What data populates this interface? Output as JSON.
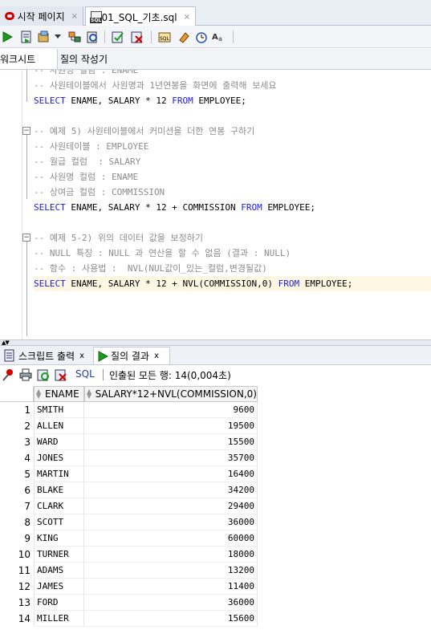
{
  "tabs": [
    {
      "label": "시작 페이지",
      "close": "×"
    },
    {
      "label": "01_SQL_기초.sql",
      "close": "×"
    }
  ],
  "worksheet_tabs": {
    "worksheet": "워크시트",
    "query_builder": "질의 작성기"
  },
  "editor": {
    "lines": [
      "-- 사원명 컬럼 : ENAME",
      "-- 사원테이블에서 사원명과 1년연봉을 화면에 출력해 보세요",
      "SELECT ENAME, SALARY * 12 FROM EMPLOYEE;",
      "",
      "-- 예제 5) 사원테이블에서 커미션을 더한 연봉 구하기",
      "-- 사원테이블 : EMPLOYEE",
      "-- 월급 컬럼  : SALARY",
      "-- 사원명 컬럼 : ENAME",
      "-- 상여금 컬럼 : COMMISSION",
      "SELECT ENAME, SALARY * 12 + COMMISSION FROM EMPLOYEE;",
      "",
      "-- 예제 5-2) 위의 데이터 값을 보정하기",
      "-- NULL 특징 : NULL 과 연산을 할 수 없음 (결과 : NULL)",
      "-- 함수 : 사용법 :  NVL(NUL값이_있는_컬럼,변경될값)",
      "SELECT ENAME, SALARY * 12 + NVL(COMMISSION,0) FROM EMPLOYEE;"
    ]
  },
  "output_tabs": [
    {
      "label": "스크립트 출력",
      "close": "x"
    },
    {
      "label": "질의 결과",
      "close": "x"
    }
  ],
  "result_toolbar": {
    "sql_label": "SQL",
    "status": "인출된 모든 행: 14(0,004초)"
  },
  "results": {
    "columns": [
      "ENAME",
      "SALARY*12+NVL(COMMISSION,0)"
    ],
    "rows": [
      [
        "1",
        "SMITH",
        "9600"
      ],
      [
        "2",
        "ALLEN",
        "19500"
      ],
      [
        "3",
        "WARD",
        "15500"
      ],
      [
        "4",
        "JONES",
        "35700"
      ],
      [
        "5",
        "MARTIN",
        "16400"
      ],
      [
        "6",
        "BLAKE",
        "34200"
      ],
      [
        "7",
        "CLARK",
        "29400"
      ],
      [
        "8",
        "SCOTT",
        "36000"
      ],
      [
        "9",
        "KING",
        "60000"
      ],
      [
        "10",
        "TURNER",
        "18000"
      ],
      [
        "11",
        "ADAMS",
        "13200"
      ],
      [
        "12",
        "JAMES",
        "11400"
      ],
      [
        "13",
        "FORD",
        "36000"
      ],
      [
        "14",
        "MILLER",
        "15600"
      ]
    ]
  },
  "colors": {
    "keyword": "#1a1ae6",
    "comment": "#8c8c8c",
    "highlight_line": "#fdf7e3",
    "oracle_red": "#d10000"
  }
}
